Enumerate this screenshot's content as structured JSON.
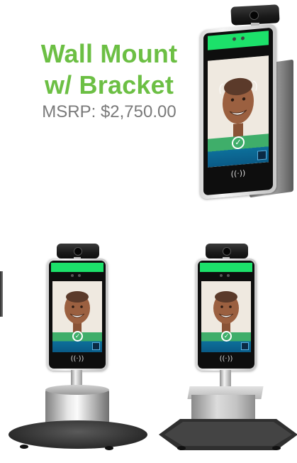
{
  "headline": {
    "line1": "Wall Mount",
    "line2": "w/ Bracket",
    "price": "MSRP: $2,750.00"
  },
  "colors": {
    "headline_green": "#6cbf44",
    "price_gray": "#7a7a7a",
    "screen_green_bar": "#1ce16a",
    "screen_blue_band": "#0d6f9a"
  },
  "devices": [
    {
      "name": "wall-mount-with-bracket",
      "icons": [
        "checkmark-icon",
        "qr-code-icon",
        "nfc-icon"
      ]
    },
    {
      "name": "round-base-stand",
      "icons": [
        "checkmark-icon",
        "qr-code-icon",
        "nfc-icon"
      ]
    },
    {
      "name": "square-base-stand",
      "icons": [
        "checkmark-icon",
        "qr-code-icon",
        "nfc-icon"
      ]
    }
  ],
  "glyphs": {
    "check": "✓",
    "nfc": "((·))"
  }
}
